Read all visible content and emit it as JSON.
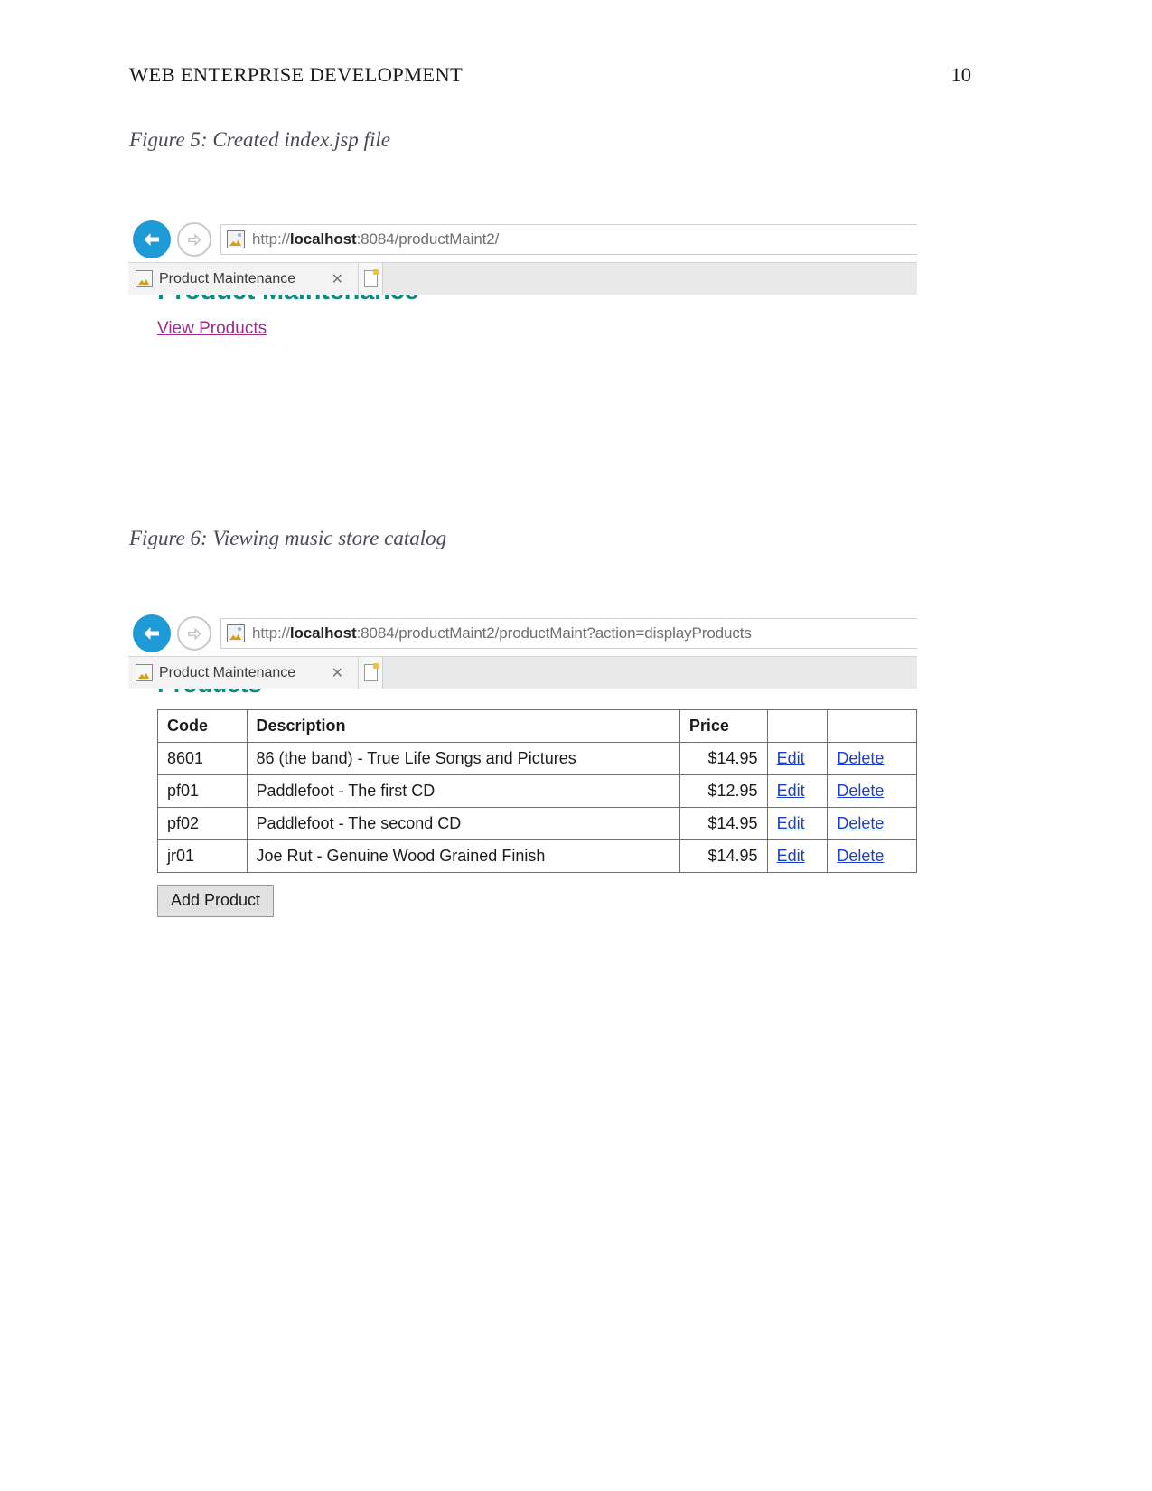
{
  "document": {
    "running_head": "WEB ENTERPRISE DEVELOPMENT",
    "page_number": "10"
  },
  "figures": [
    {
      "caption": "Figure 5: Created index.jsp file",
      "browser": {
        "url_scheme": "http://",
        "url_host": "localhost",
        "url_path": ":8084/productMaint2/",
        "url_full": "http://localhost:8084/productMaint2/",
        "tab_title": "Product Maintenance",
        "tab_close_glyph": "✕",
        "back_icon": "back-arrow-icon",
        "forward_icon": "forward-arrow-icon",
        "favicon": "page-image-icon",
        "new_tab_icon": "new-tab-icon"
      },
      "page": {
        "heading": "Product Maintenance",
        "link": "View Products"
      }
    },
    {
      "caption": "Figure 6: Viewing music store catalog",
      "browser": {
        "url_scheme": "http://",
        "url_host": "localhost",
        "url_path": ":8084/productMaint2/productMaint?action=displayProducts",
        "url_full": "http://localhost:8084/productMaint2/productMaint?action=displayProducts",
        "tab_title": "Product Maintenance",
        "tab_close_glyph": "✕",
        "back_icon": "back-arrow-icon",
        "forward_icon": "forward-arrow-icon",
        "favicon": "page-image-icon",
        "new_tab_icon": "new-tab-icon"
      },
      "page": {
        "heading": "Products",
        "table": {
          "headers": [
            "Code",
            "Description",
            "Price",
            "",
            ""
          ],
          "rows": [
            {
              "code": "8601",
              "description": "86 (the band) - True Life Songs and Pictures",
              "price": "$14.95",
              "edit": "Edit",
              "delete": "Delete"
            },
            {
              "code": "pf01",
              "description": "Paddlefoot - The first CD",
              "price": "$12.95",
              "edit": "Edit",
              "delete": "Delete"
            },
            {
              "code": "pf02",
              "description": "Paddlefoot - The second CD",
              "price": "$14.95",
              "edit": "Edit",
              "delete": "Delete"
            },
            {
              "code": "jr01",
              "description": "Joe Rut - Genuine Wood Grained Finish",
              "price": "$14.95",
              "edit": "Edit",
              "delete": "Delete"
            }
          ]
        },
        "add_button": "Add Product"
      }
    }
  ],
  "colors": {
    "heading_teal": "#14887f",
    "visited_link_purple": "#9b2d91",
    "link_blue": "#1a3fd0",
    "back_button_blue": "#1e9ad6"
  }
}
